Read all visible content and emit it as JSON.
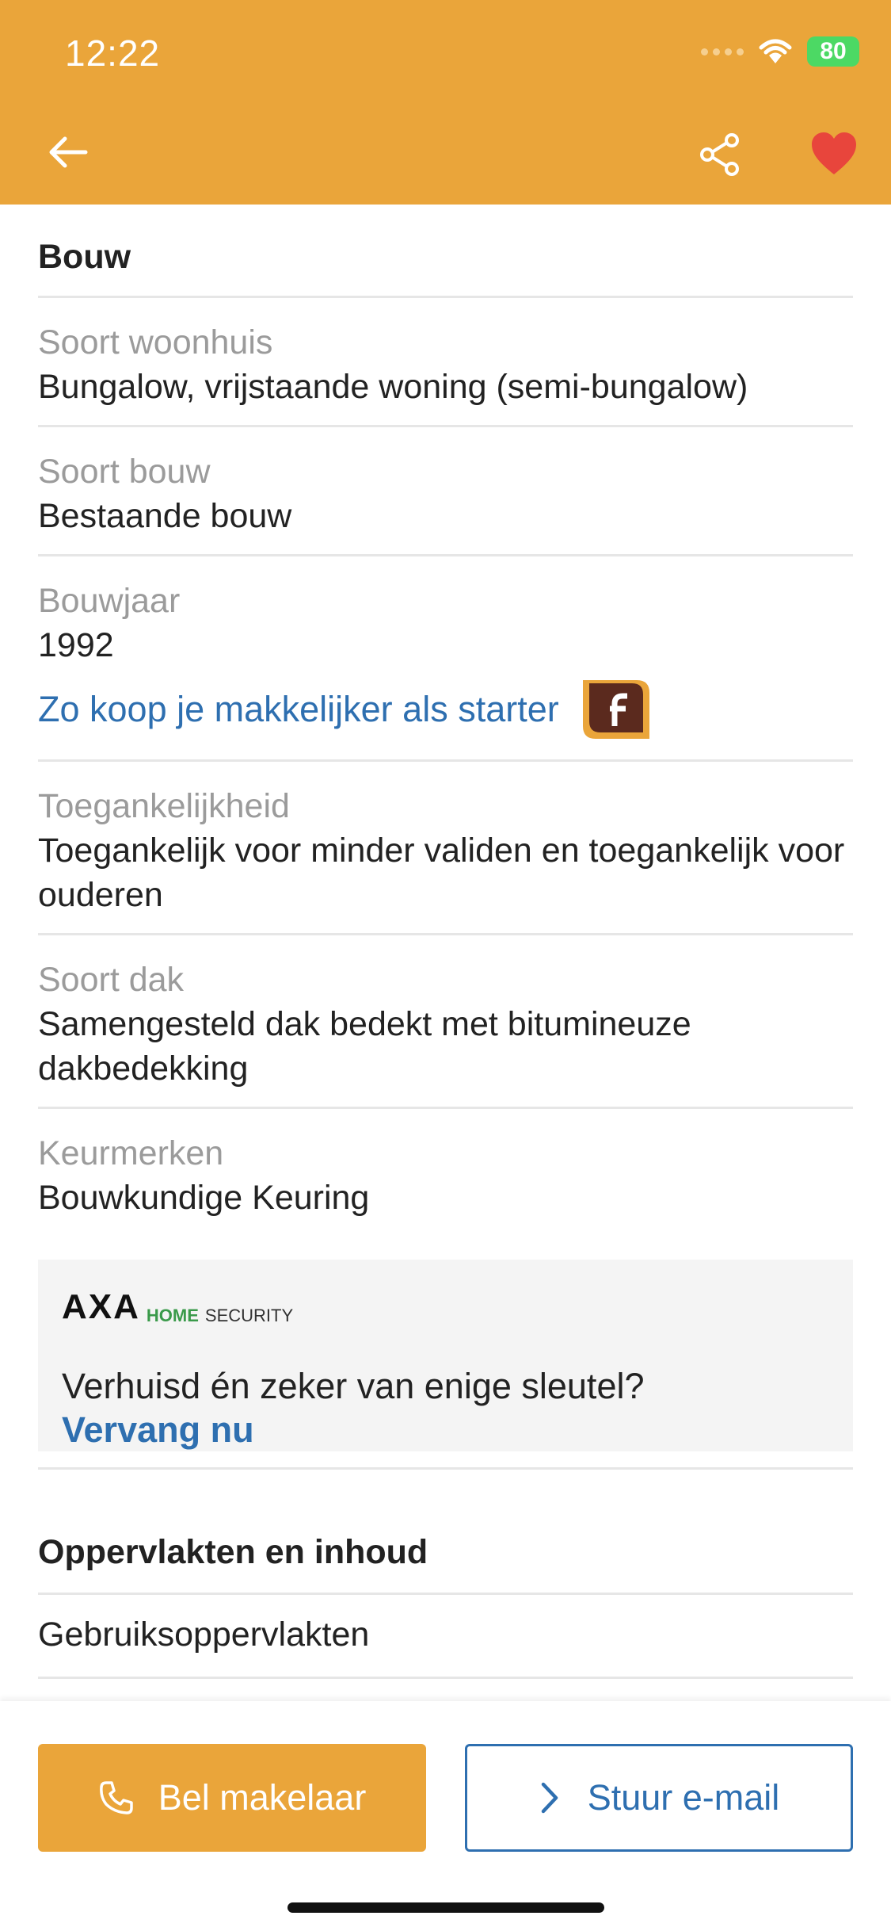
{
  "status_bar": {
    "time": "12:22",
    "battery": "80"
  },
  "header": {
    "back_icon": "arrow-left-icon",
    "share_icon": "share-icon",
    "favorite_icon": "heart-icon"
  },
  "section_bouw": {
    "title": "Bouw",
    "rows": [
      {
        "label": "Soort woonhuis",
        "value": "Bungalow, vrijstaande woning (semi-bungalow)"
      },
      {
        "label": "Soort bouw",
        "value": "Bestaande bouw"
      },
      {
        "label": "Bouwjaar",
        "value": "1992"
      },
      {
        "label": "Toegankelijkheid",
        "value": "Toegankelijk voor minder validen en toegankelijk voor ouderen"
      },
      {
        "label": "Soort dak",
        "value": "Samengesteld dak bedekt met bitumineuze dakbedekking"
      },
      {
        "label": "Keurmerken",
        "value": "Bouwkundige Keuring"
      }
    ],
    "starter_link": "Zo koop je makkelijker als starter"
  },
  "ad": {
    "brand": "AXA",
    "brand_home": "HOME",
    "brand_security": "SECURITY",
    "text": "Verhuisd én zeker van enige sleutel?",
    "link": "Vervang nu"
  },
  "section_oppervlakten": {
    "title": "Oppervlakten en inhoud",
    "sub": "Gebruiksoppervlakten"
  },
  "actions": {
    "call_label": "Bel makelaar",
    "email_label": "Stuur e-mail"
  },
  "colors": {
    "accent": "#EAA53A",
    "link": "#2E6FB0",
    "heart": "#E8453C"
  }
}
